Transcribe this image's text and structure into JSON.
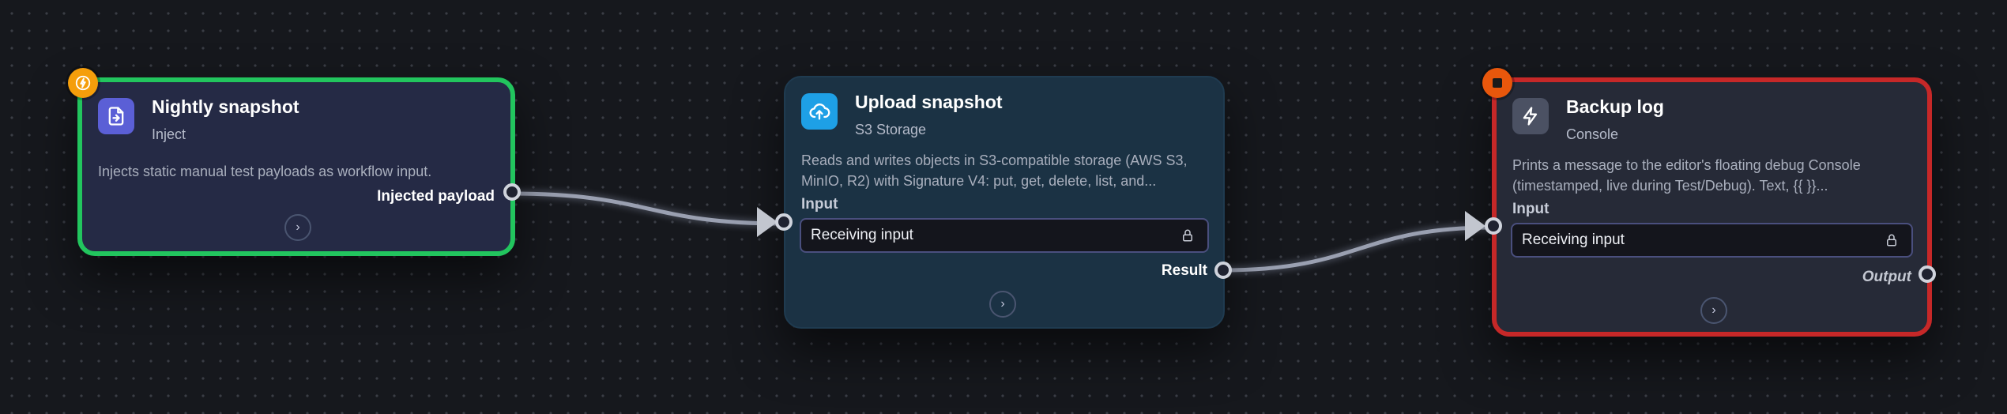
{
  "nodes": [
    {
      "title": "Nightly snapshot",
      "subtitle": "Inject",
      "description": "Injects static manual test payloads as workflow input.",
      "output_label": "Injected payload",
      "status": "running",
      "icon": "file-import-icon",
      "icon_color": "#5b5fd6",
      "border_color": "#22c55e"
    },
    {
      "title": "Upload snapshot",
      "subtitle": "S3 Storage",
      "description_line1": "Reads and writes objects in S3-compatible storage (AWS S3,",
      "description_line2": "MinIO, R2) with Signature V4: put, get, delete, list, and...",
      "input_label": "Input",
      "input_value": "Receiving input",
      "output_label": "Result",
      "icon": "cloud-upload-icon",
      "icon_color": "#1ea0e6"
    },
    {
      "title": "Backup log",
      "subtitle": "Console",
      "description_line1": "Prints a message to the editor's floating debug Console",
      "description_line2": "(timestamped, live during Test/Debug). Text, {{ }}...",
      "input_label": "Input",
      "input_value": "Receiving input",
      "output_label": "Output",
      "status": "stopped",
      "icon": "lightning-icon",
      "icon_color": "#4b5163",
      "border_color": "#c62828"
    }
  ],
  "colors": {
    "success": "#22c55e",
    "error": "#c62828",
    "warning": "#f59e0b"
  }
}
